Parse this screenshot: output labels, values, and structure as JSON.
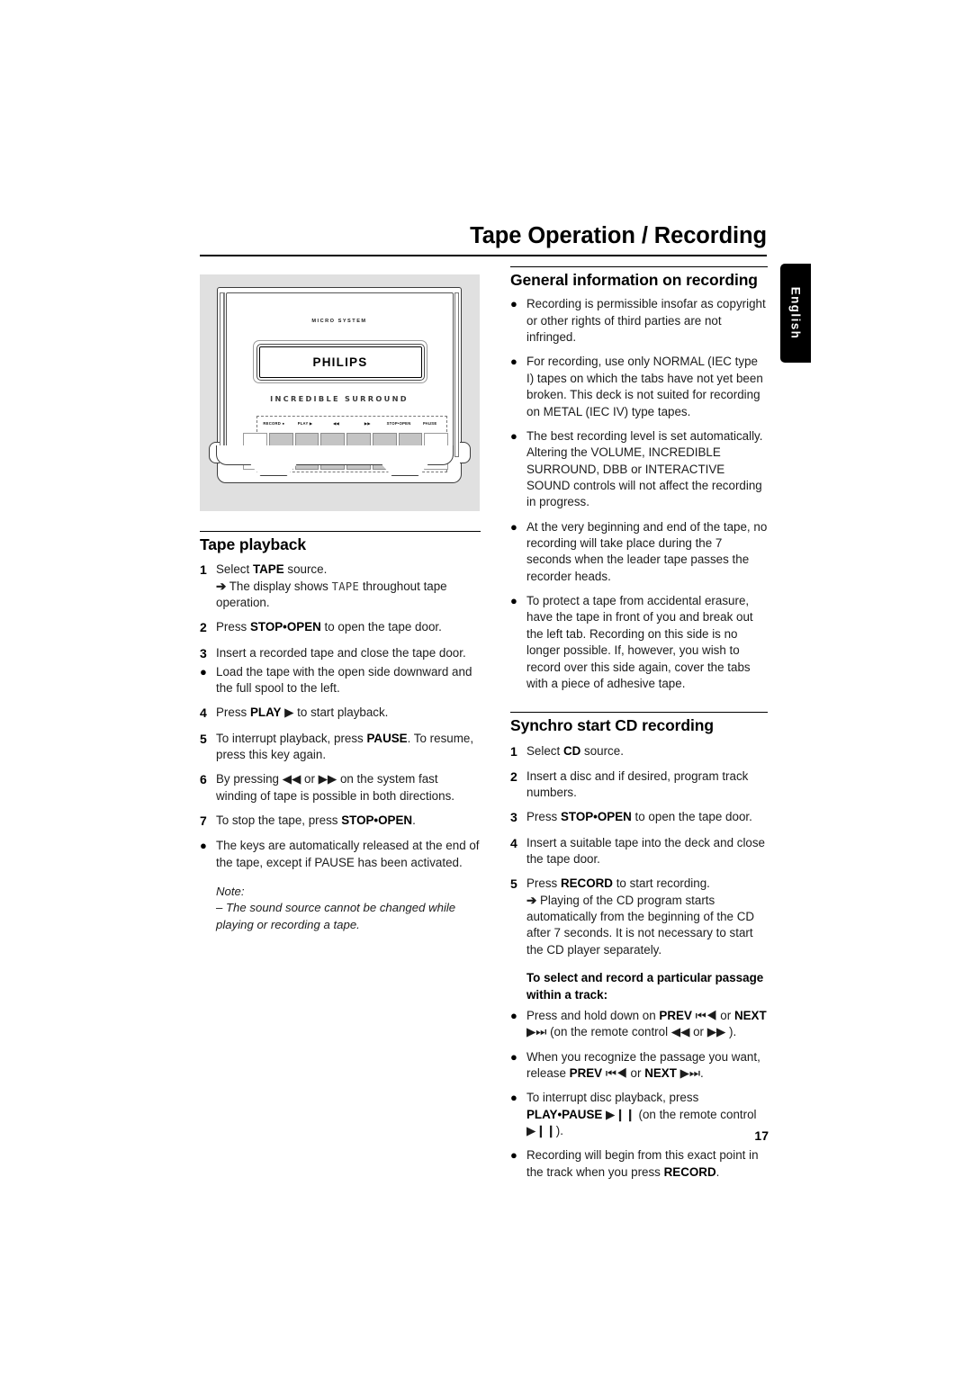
{
  "header": {
    "title": "Tape Operation / Recording",
    "language_tab": "English"
  },
  "figure": {
    "micro_system": "MICRO SYSTEM",
    "brand": "PHILIPS",
    "incredible_surround": "INCREDIBLE  SURROUND",
    "button_labels": [
      "RECORD ●",
      "PLAY ▶",
      "◀◀",
      "▶▶",
      "STOP•OPEN",
      "PAUSE"
    ]
  },
  "left_column": {
    "tape_playback": {
      "heading": "Tape playback",
      "items": [
        {
          "marker": "1",
          "parts": [
            {
              "t": "Select "
            },
            {
              "t": "TAPE",
              "b": true
            },
            {
              "t": " source."
            }
          ],
          "sub": {
            "arrow": "➔",
            "pre": " The display shows ",
            "lcd": "TAPE",
            "post": " throughout tape operation."
          }
        },
        {
          "marker": "2",
          "parts": [
            {
              "t": "Press "
            },
            {
              "t": "STOP•OPEN",
              "b": true
            },
            {
              "t": " to open the tape door."
            }
          ]
        },
        {
          "marker": "3",
          "tight": true,
          "parts": [
            {
              "t": "Insert a recorded tape and close the tape door."
            }
          ]
        },
        {
          "marker": "●",
          "dot": true,
          "parts": [
            {
              "t": "Load the tape with the open side downward and the full spool to the left."
            }
          ]
        },
        {
          "marker": "4",
          "parts": [
            {
              "t": "Press "
            },
            {
              "t": "PLAY",
              "b": true
            },
            {
              "t": " ▶ to start playback."
            }
          ]
        },
        {
          "marker": "5",
          "parts": [
            {
              "t": "To interrupt playback, press "
            },
            {
              "t": "PAUSE",
              "b": true
            },
            {
              "t": ". To resume, press this key again."
            }
          ]
        },
        {
          "marker": "6",
          "parts": [
            {
              "t": "By pressing ◀◀ or ▶▶ on the system fast winding of tape is possible in both directions."
            }
          ]
        },
        {
          "marker": "7",
          "parts": [
            {
              "t": "To stop the tape, press "
            },
            {
              "t": "STOP•OPEN",
              "b": true
            },
            {
              "t": "."
            }
          ]
        },
        {
          "marker": "●",
          "dot": true,
          "parts": [
            {
              "t": "The keys are automatically released at the end of the tape, except if PAUSE has been activated."
            }
          ]
        }
      ],
      "note": {
        "label": "Note:",
        "text": "–  The sound source cannot be changed while playing or recording a tape."
      }
    }
  },
  "right_column": {
    "general_info": {
      "heading": "General information on recording",
      "items": [
        {
          "marker": "●",
          "dot": true,
          "parts": [
            {
              "t": "Recording is permissible insofar as copyright or other rights of third parties are not infringed."
            }
          ]
        },
        {
          "marker": "●",
          "dot": true,
          "parts": [
            {
              "t": "For recording, use only NORMAL (IEC type I) tapes on which the tabs have not yet been broken. This deck is not suited for recording on METAL (IEC IV) type tapes."
            }
          ]
        },
        {
          "marker": "●",
          "dot": true,
          "parts": [
            {
              "t": "The best recording level is set automatically. Altering the VOLUME, INCREDIBLE SURROUND, DBB or INTERACTIVE SOUND controls will not affect the recording in progress."
            }
          ]
        },
        {
          "marker": "●",
          "dot": true,
          "parts": [
            {
              "t": "At the very beginning and end of the tape, no recording will take place during the 7 seconds when the leader tape passes the recorder heads."
            }
          ]
        },
        {
          "marker": "●",
          "dot": true,
          "parts": [
            {
              "t": "To protect a tape from accidental erasure, have the tape in front of you and break out the left tab. Recording on this side is no longer possible. If, however, you wish to record over this side again, cover the tabs with a piece of adhesive tape."
            }
          ]
        }
      ]
    },
    "synchro": {
      "heading": "Synchro start CD recording",
      "items": [
        {
          "marker": "1",
          "parts": [
            {
              "t": "Select "
            },
            {
              "t": "CD",
              "b": true
            },
            {
              "t": " source."
            }
          ]
        },
        {
          "marker": "2",
          "parts": [
            {
              "t": "Insert a disc and if desired, program track numbers."
            }
          ]
        },
        {
          "marker": "3",
          "parts": [
            {
              "t": "Press "
            },
            {
              "t": "STOP•OPEN",
              "b": true
            },
            {
              "t": " to open the tape door."
            }
          ]
        },
        {
          "marker": "4",
          "parts": [
            {
              "t": "Insert a suitable tape into the deck and close the tape door."
            }
          ]
        },
        {
          "marker": "5",
          "parts": [
            {
              "t": "Press "
            },
            {
              "t": "RECORD",
              "b": true
            },
            {
              "t": " to start recording."
            }
          ],
          "sub": {
            "arrow": "➔",
            "pre": " Playing of the CD program starts automatically from the beginning of the CD after 7 seconds. It is not necessary to start the CD player separately.",
            "lcd": "",
            "post": ""
          }
        }
      ],
      "sub_head": "To select and record a particular passage within a track:",
      "sub_items": [
        {
          "marker": "●",
          "dot": true,
          "parts": [
            {
              "t": "Press and hold down on "
            },
            {
              "t": "PREV",
              "b": true
            },
            {
              "t": " ⏮◀ or "
            },
            {
              "t": "NEXT",
              "b": true
            },
            {
              "t": " ▶⏭ (on the remote control ◀◀ or ▶▶ )."
            }
          ]
        },
        {
          "marker": "●",
          "dot": true,
          "parts": [
            {
              "t": "When you recognize the passage you want, release "
            },
            {
              "t": "PREV",
              "b": true
            },
            {
              "t": " ⏮◀ or "
            },
            {
              "t": "NEXT",
              "b": true
            },
            {
              "t": " ▶⏭."
            }
          ]
        },
        {
          "marker": "●",
          "dot": true,
          "parts": [
            {
              "t": "To interrupt disc playback, press "
            },
            {
              "t": "PLAY•PAUSE",
              "b": true
            },
            {
              "t": " ▶❙❙ (on the remote control ▶❙❙)."
            }
          ]
        },
        {
          "marker": "●",
          "dot": true,
          "parts": [
            {
              "t": "Recording will begin from this exact point in the track when you press "
            },
            {
              "t": "RECORD",
              "b": true
            },
            {
              "t": "."
            }
          ]
        }
      ]
    }
  },
  "footer": {
    "page_number": "17"
  }
}
